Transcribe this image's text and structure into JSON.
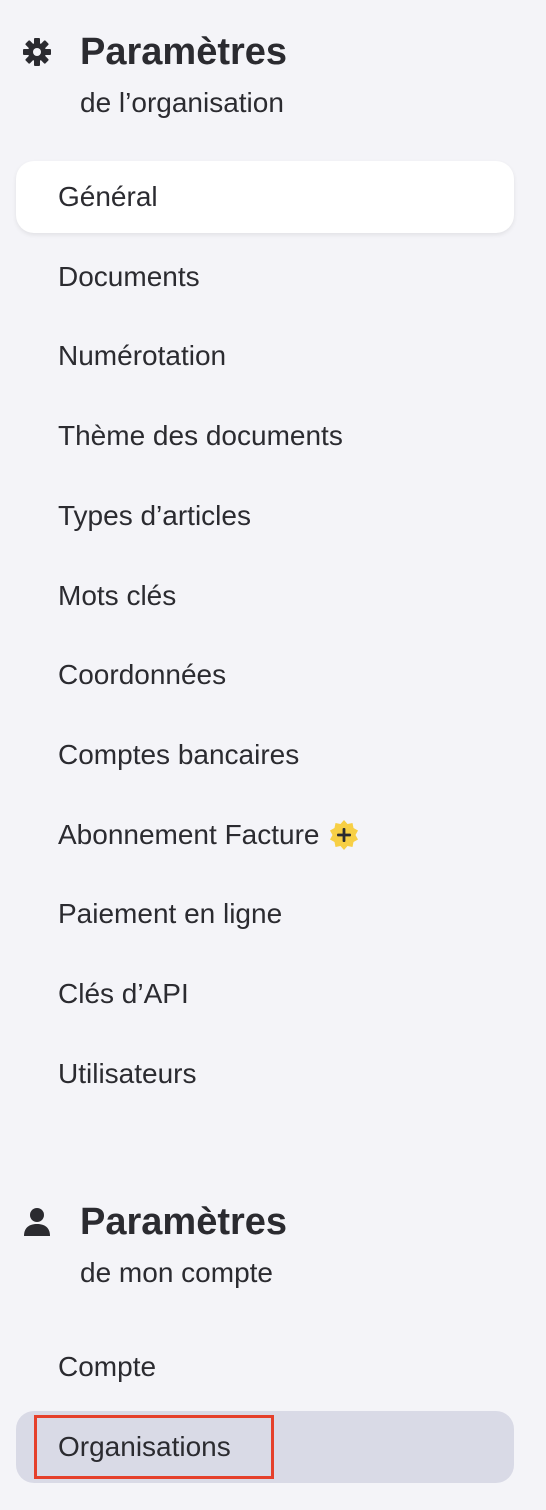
{
  "org_settings": {
    "title": "Paramètres",
    "subtitle": "de l’organisation",
    "icon": "gear-icon",
    "items": [
      {
        "label": "Général"
      },
      {
        "label": "Documents"
      },
      {
        "label": "Numérotation"
      },
      {
        "label": "Thème des documents"
      },
      {
        "label": "Types d’articles"
      },
      {
        "label": "Mots clés"
      },
      {
        "label": "Coordonnées"
      },
      {
        "label": "Comptes bancaires"
      },
      {
        "label": "Abonnement Facture",
        "badge": "plus-badge-icon"
      },
      {
        "label": "Paiement en ligne"
      },
      {
        "label": "Clés d’API"
      },
      {
        "label": "Utilisateurs"
      }
    ]
  },
  "account_settings": {
    "title": "Paramètres",
    "subtitle": "de mon compte",
    "icon": "user-icon",
    "items": [
      {
        "label": "Compte"
      },
      {
        "label": "Organisations"
      }
    ]
  },
  "colors": {
    "background": "#f4f4f8",
    "active_bg": "#ffffff",
    "selected_bg": "#d9dae6",
    "highlight": "#e5402b",
    "badge": "#f7cf45"
  }
}
